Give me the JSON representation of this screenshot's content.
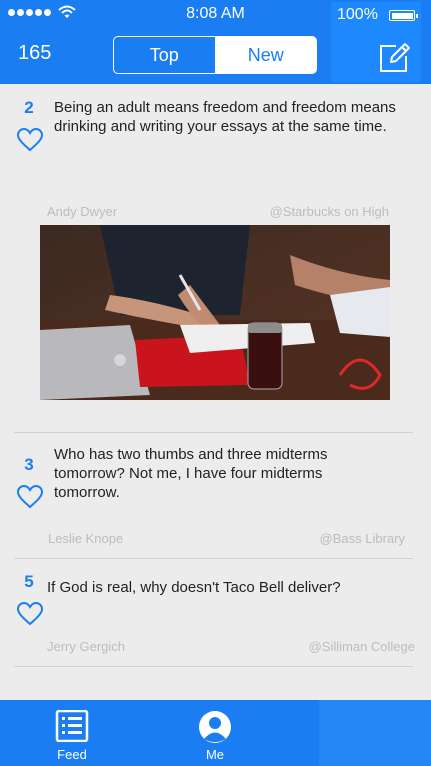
{
  "status": {
    "time": "8:08 AM",
    "battery": "100%",
    "battery_level": 1.0
  },
  "header": {
    "score": "165",
    "tabs": [
      "Top",
      "New"
    ],
    "selected_tab": "New"
  },
  "posts": [
    {
      "number": "2",
      "text": "Being an adult means freedom and freedom means drinking and writing your essays at the same time.",
      "author": "Andy Dwyer",
      "location": "@Starbucks on High",
      "has_photo": true
    },
    {
      "number": "3",
      "text": "Who has two thumbs and three midterms tomorrow? Not me, I have four midterms tomorrow.",
      "author": "Leslie Knope",
      "location": "@Bass Library"
    },
    {
      "number": "5",
      "text": "If God is real, why doesn't Taco Bell deliver?",
      "author": "Jerry Gergich",
      "location": "@Silliman College"
    }
  ],
  "tabbar": {
    "feed_label": "Feed",
    "me_label": "Me"
  },
  "colors": {
    "accent": "#1a7ef2",
    "background": "#ececec",
    "meta_text": "#bcbcbc"
  },
  "icons": [
    "wifi-icon",
    "battery-icon",
    "compose-icon",
    "heart-icon",
    "feed-list-icon",
    "profile-icon"
  ]
}
